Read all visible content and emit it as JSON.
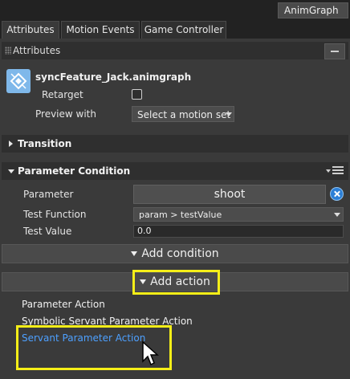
{
  "topbar": {
    "anim_button_label": "AnimGraph"
  },
  "tabs": [
    {
      "label": "Attributes",
      "active": true
    },
    {
      "label": "Motion Events",
      "active": false
    },
    {
      "label": "Game Controller",
      "active": false
    }
  ],
  "attributes_panel": {
    "title": "Attributes"
  },
  "node": {
    "name": "syncFeature_Jack.animgraph",
    "retarget_label": "Retarget",
    "retarget_checked": false,
    "preview_label": "Preview with",
    "preview_value": "Select a motion set"
  },
  "sections": {
    "transition": {
      "title": "Transition",
      "expanded": false
    },
    "parameter_condition": {
      "title": "Parameter Condition",
      "expanded": true
    }
  },
  "condition": {
    "parameter_label": "Parameter",
    "parameter_value": "shoot",
    "test_function_label": "Test Function",
    "test_function_value": "param > testValue",
    "test_value_label": "Test Value",
    "test_value": "0.0"
  },
  "buttons": {
    "add_condition": "Add condition",
    "add_action": "Add action"
  },
  "action_menu": [
    "Parameter Action",
    "Symbolic Servant Parameter Action",
    "Servant Parameter Action"
  ],
  "colors": {
    "highlight": "#f5ee18",
    "link": "#4da0ff",
    "accent_icon": "#7fb8ea"
  },
  "icons": {
    "node": "animgraph-node-icon",
    "clear": "clear-icon",
    "cursor": "mouse-cursor-icon"
  }
}
